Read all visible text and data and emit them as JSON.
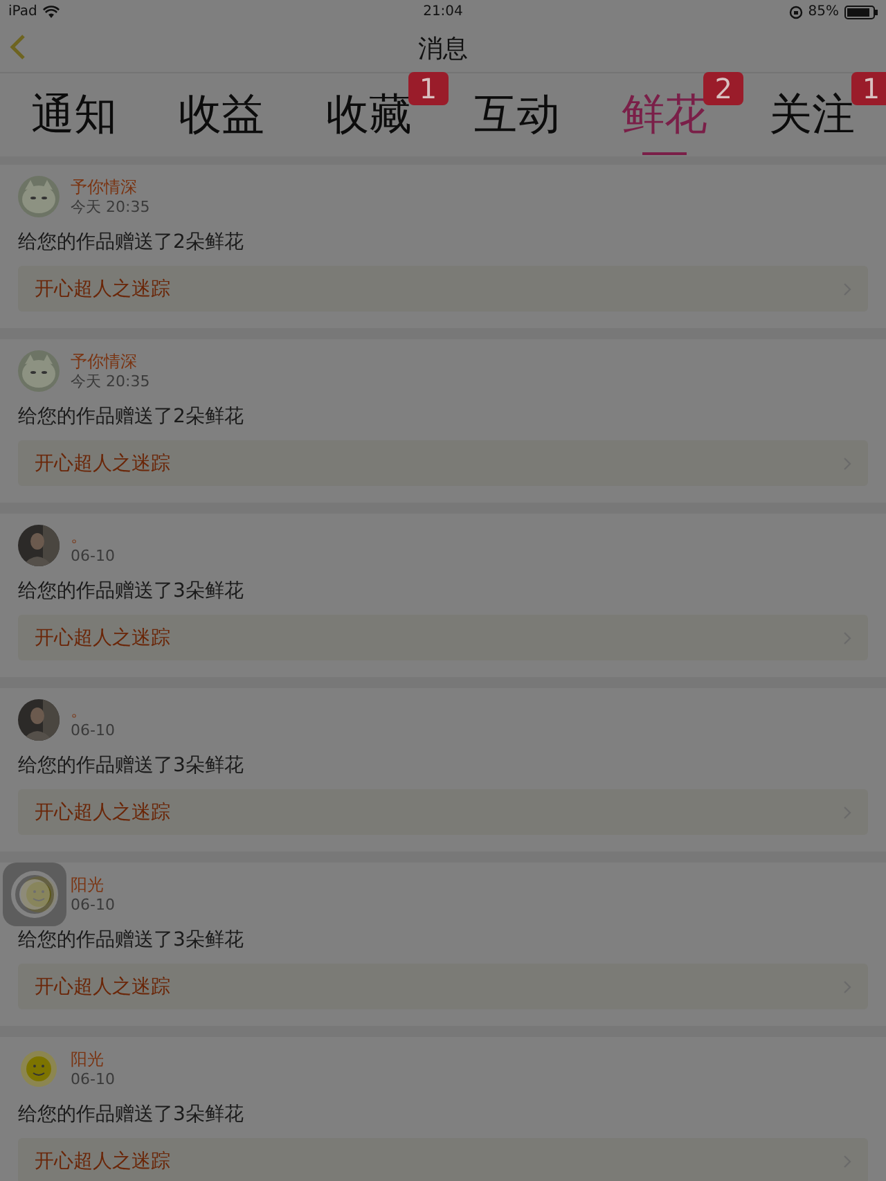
{
  "status_bar": {
    "device": "iPad",
    "time": "21:04",
    "battery": "85%"
  },
  "nav": {
    "title": "消息"
  },
  "tabs": [
    {
      "label": "通知",
      "selected": false
    },
    {
      "label": "收益",
      "selected": false
    },
    {
      "label": "收藏",
      "selected": false,
      "badge": "1"
    },
    {
      "label": "互动",
      "selected": false
    },
    {
      "label": "鲜花",
      "selected": true,
      "badge": "2"
    },
    {
      "label": "关注",
      "selected": false,
      "badge": "1"
    }
  ],
  "messages": [
    {
      "name": "予你情深",
      "time": "今天 20:35",
      "text": "给您的作品赠送了2朵鲜花",
      "work": "开心超人之迷踪"
    },
    {
      "name": "予你情深",
      "time": "今天 20:35",
      "text": "给您的作品赠送了2朵鲜花",
      "work": "开心超人之迷踪"
    },
    {
      "name": "。",
      "time": "06-10",
      "text": "给您的作品赠送了3朵鲜花",
      "work": "开心超人之迷踪"
    },
    {
      "name": "。",
      "time": "06-10",
      "text": "给您的作品赠送了3朵鲜花",
      "work": "开心超人之迷踪"
    },
    {
      "name": "阳光",
      "time": "06-10",
      "text": "给您的作品赠送了3朵鲜花",
      "work": "开心超人之迷踪"
    },
    {
      "name": "阳光",
      "time": "06-10",
      "text": "给您的作品赠送了3朵鲜花",
      "work": "开心超人之迷踪"
    }
  ],
  "assistive_touch": {
    "visible": true
  }
}
